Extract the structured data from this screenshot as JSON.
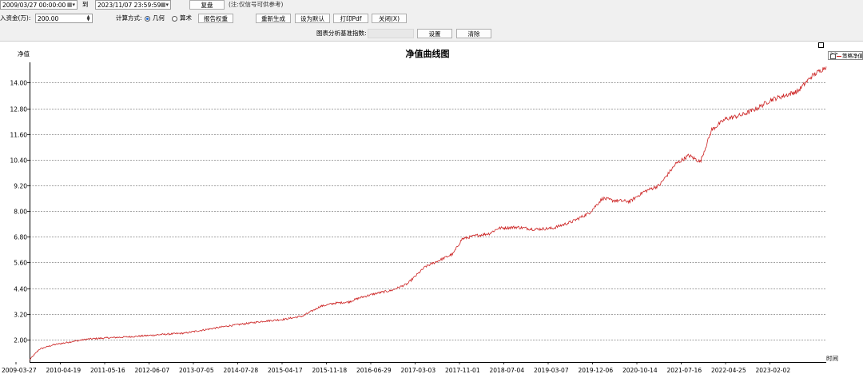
{
  "toolbar": {
    "start_date": "2009/03/27 00:00:00",
    "to_label": "到",
    "end_date": "2023/11/07 23:59:59",
    "replay_button": "复盘",
    "note": "(注:仅信号可供参考)",
    "capital_label": "入资金(万):",
    "capital_value": "200.00",
    "calc_label": "计算方式:",
    "calc_options": [
      "几何",
      "算术"
    ],
    "calc_selected": "几何",
    "report_weight_button": "报告权重",
    "regenerate_button": "重新生成",
    "set_default_button": "设为默认",
    "print_pdf_button": "打印Pdf",
    "close_button": "关闭(X)",
    "benchmark_label": "图表分析基准指数:",
    "benchmark_value": "",
    "settings_button": "设置",
    "clear_button": "清除"
  },
  "legend": {
    "expand_label": ">>",
    "series_label": "策略净值"
  },
  "colors": {
    "line": "#cc2222",
    "grid": "#444444",
    "background": "#ffffff",
    "radio_accent": "#1e6ad8"
  },
  "chart_data": {
    "type": "line",
    "title": "净值曲线图",
    "ylabel": "净值",
    "xlabel": "时间",
    "ylim": [
      0.95,
      14.95
    ],
    "y_ticks": [
      2.0,
      3.2,
      4.4,
      5.6,
      6.8,
      8.0,
      9.2,
      10.4,
      11.6,
      12.8,
      14.0
    ],
    "y_tick_labels": [
      "2.00",
      "3.20",
      "4.40",
      "5.60",
      "6.80",
      "8.00",
      "9.20",
      "10.40",
      "11.60",
      "12.80",
      "14.00"
    ],
    "x_tick_labels": [
      "2009-03-27",
      "2010-04-19",
      "2011-05-16",
      "2012-06-07",
      "2013-07-05",
      "2014-07-28",
      "2015-04-17",
      "2015-11-18",
      "2016-06-29",
      "2017-03-03",
      "2017-11-01",
      "2018-07-04",
      "2019-03-07",
      "2019-12-06",
      "2020-10-14",
      "2021-07-16",
      "2022-04-25",
      "2023-02-02"
    ],
    "grid": "horizontal-dashed",
    "legend_position": "top-right",
    "series": [
      {
        "name": "策略净值",
        "x": [
          "2009-03-27",
          "2009-06-01",
          "2009-09-01",
          "2010-01-01",
          "2010-04-19",
          "2010-09-01",
          "2011-01-01",
          "2011-05-16",
          "2011-10-01",
          "2012-02-01",
          "2012-06-07",
          "2012-12-01",
          "2013-07-05",
          "2013-12-01",
          "2014-04-01",
          "2014-07-28",
          "2014-11-01",
          "2015-02-01",
          "2015-04-17",
          "2015-08-01",
          "2015-11-18",
          "2016-03-01",
          "2016-06-29",
          "2016-10-01",
          "2017-01-01",
          "2017-03-03",
          "2017-06-01",
          "2017-09-01",
          "2017-11-01",
          "2018-03-01",
          "2018-07-04",
          "2018-11-01",
          "2019-03-07",
          "2019-07-01",
          "2019-10-01",
          "2019-12-06",
          "2020-04-01",
          "2020-07-01",
          "2020-10-14",
          "2021-02-01",
          "2021-05-01",
          "2021-07-16",
          "2021-10-01",
          "2022-01-01",
          "2022-04-25",
          "2022-08-01",
          "2022-11-01",
          "2023-02-02",
          "2023-05-01",
          "2023-08-01",
          "2023-11-07"
        ],
        "y": [
          1.05,
          1.55,
          1.75,
          1.9,
          2.02,
          2.08,
          2.12,
          2.18,
          2.25,
          2.3,
          2.45,
          2.65,
          2.85,
          2.95,
          3.1,
          3.55,
          3.7,
          3.75,
          3.95,
          4.15,
          4.3,
          4.6,
          5.4,
          5.7,
          6.0,
          6.7,
          6.85,
          6.95,
          7.2,
          7.25,
          7.15,
          7.2,
          7.5,
          7.9,
          8.6,
          8.5,
          8.45,
          8.9,
          9.2,
          10.2,
          10.6,
          10.3,
          11.8,
          12.3,
          12.5,
          12.8,
          13.2,
          13.4,
          13.6,
          14.3,
          14.75
        ]
      }
    ]
  }
}
